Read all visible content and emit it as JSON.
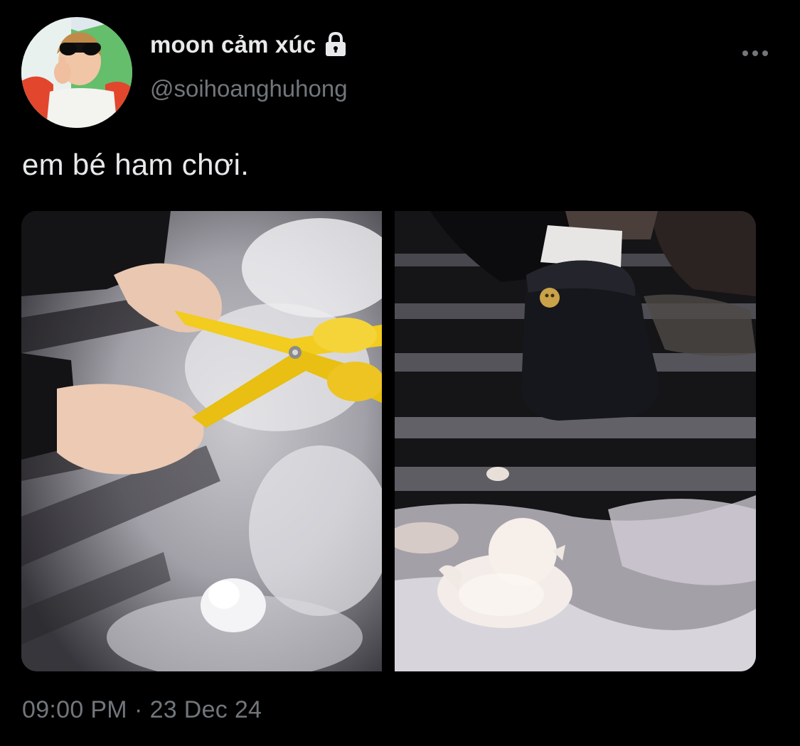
{
  "author": {
    "display_name": "moon cảm xúc",
    "handle": "@soihoanghuhong",
    "avatar_icon": "avatar-child-sunglasses",
    "protected_icon": "lock-icon"
  },
  "menu": {
    "more_icon": "ellipsis-icon"
  },
  "tweet": {
    "text": "em bé ham chơi."
  },
  "media": [
    {
      "description_icon": "photo-snowball-maker"
    },
    {
      "description_icon": "photo-snow-duck"
    }
  ],
  "meta": {
    "time": "09:00 PM",
    "separator": "·",
    "date": "23 Dec 24"
  },
  "colors": {
    "background": "#000000",
    "primary_text": "#e7e9ea",
    "secondary_text": "#71767b",
    "toy_yellow": "#f2cc1e"
  }
}
